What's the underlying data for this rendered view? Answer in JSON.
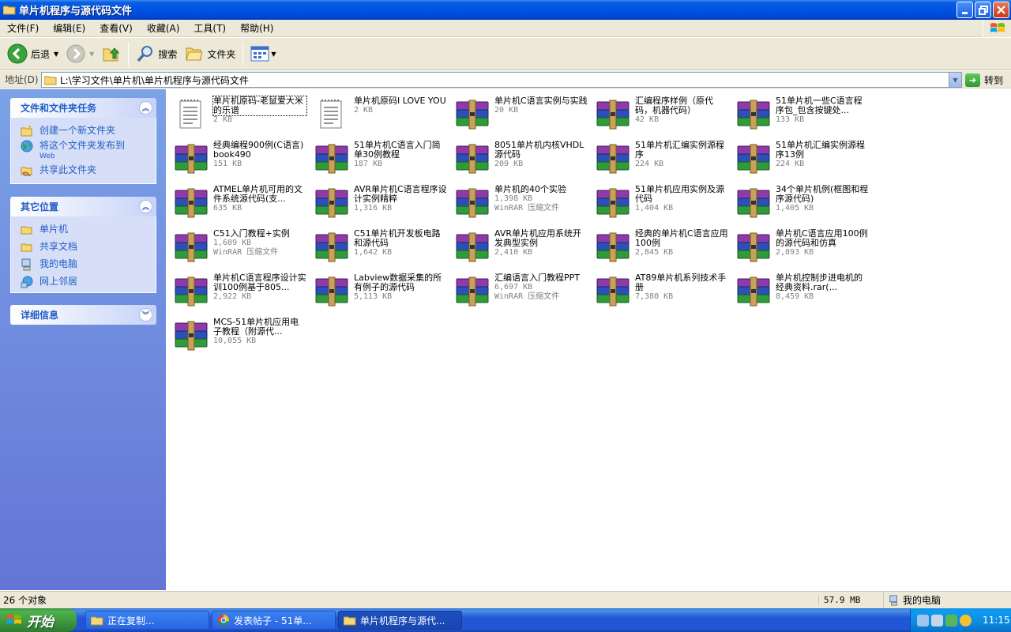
{
  "window": {
    "title": "单片机程序与源代码文件"
  },
  "menu": [
    "文件(F)",
    "编辑(E)",
    "查看(V)",
    "收藏(A)",
    "工具(T)",
    "帮助(H)"
  ],
  "toolbar": {
    "back": "后退",
    "search": "搜索",
    "folders": "文件夹"
  },
  "address": {
    "label": "地址(D)",
    "path": "L:\\学习文件\\单片机\\单片机程序与源代码文件",
    "go": "转到"
  },
  "left_pane": {
    "tasks": {
      "title": "文件和文件夹任务",
      "items": [
        "创建一个新文件夹",
        "将这个文件夹发布到",
        "共享此文件夹"
      ],
      "publish_sub": "Web"
    },
    "places": {
      "title": "其它位置",
      "items": [
        "单片机",
        "共享文档",
        "我的电脑",
        "网上邻居"
      ]
    },
    "details": {
      "title": "详细信息"
    }
  },
  "files": [
    {
      "name": "单片机原码-老鼠爱大米的乐谱",
      "meta": "2 KB",
      "type": "txt"
    },
    {
      "name": "单片机原码I LOVE YOU",
      "meta": "2 KB",
      "type": "txt"
    },
    {
      "name": "单片机C语言实例与实践",
      "meta": "20 KB",
      "type": "rar"
    },
    {
      "name": "汇编程序样例（原代码，机器代码）",
      "meta": "42 KB",
      "type": "rar"
    },
    {
      "name": "51单片机一些C语言程序包_包含按键处...",
      "meta": "133 KB",
      "type": "rar"
    },
    {
      "name": "经典编程900例(C语言) book490",
      "meta": "151 KB",
      "type": "rar"
    },
    {
      "name": "51单片机C语言入门简单30例教程",
      "meta": "187 KB",
      "type": "rar"
    },
    {
      "name": "8051单片机内核VHDL源代码",
      "meta": "209 KB",
      "type": "rar"
    },
    {
      "name": "51单片机汇编实例源程序",
      "meta": "224 KB",
      "type": "rar"
    },
    {
      "name": "51单片机汇编实例源程序13例",
      "meta": "224 KB",
      "type": "rar"
    },
    {
      "name": "ATMEL单片机可用的文件系统源代码(支...",
      "meta": "635 KB",
      "type": "rar"
    },
    {
      "name": "AVR单片机C语言程序设计实例精粹",
      "meta": "1,316 KB",
      "type": "rar"
    },
    {
      "name": "单片机的40个实验",
      "meta": "1,398 KB",
      "meta2": "WinRAR 压缩文件",
      "type": "rar"
    },
    {
      "name": "51单片机应用实例及源代码",
      "meta": "1,404 KB",
      "type": "rar"
    },
    {
      "name": "34个单片机例(框图和程序源代码)",
      "meta": "1,405 KB",
      "type": "rar"
    },
    {
      "name": "C51入门教程+实例",
      "meta": "1,609 KB",
      "meta2": "WinRAR 压缩文件",
      "type": "rar"
    },
    {
      "name": "C51单片机开发板电路和源代码",
      "meta": "1,642 KB",
      "type": "rar"
    },
    {
      "name": "AVR单片机应用系统开发典型实例",
      "meta": "2,410 KB",
      "type": "rar"
    },
    {
      "name": "经典的单片机C语言应用100例",
      "meta": "2,845 KB",
      "type": "rar"
    },
    {
      "name": "单片机C语言应用100例的源代码和仿真",
      "meta": "2,893 KB",
      "type": "rar"
    },
    {
      "name": "单片机C语言程序设计实训100例基于805...",
      "meta": "2,922 KB",
      "type": "rar"
    },
    {
      "name": "Labview数据采集的所有例子的源代码",
      "meta": "5,113 KB",
      "type": "rar"
    },
    {
      "name": "汇编语言入门教程PPT",
      "meta": "6,697 KB",
      "meta2": "WinRAR 压缩文件",
      "type": "rar"
    },
    {
      "name": "AT89单片机系列技术手册",
      "meta": "7,380 KB",
      "type": "rar"
    },
    {
      "name": "单片机控制步进电机的经典资料.rar(...",
      "meta": "8,459 KB",
      "type": "rar"
    },
    {
      "name": "MCS-51单片机应用电子教程（附源代...",
      "meta": "10,055 KB",
      "type": "rar"
    }
  ],
  "status": {
    "count": "26 个对象",
    "size": "57.9 MB",
    "location": "我的电脑"
  },
  "taskbar": {
    "start": "开始",
    "tasks": [
      "正在复制...",
      "发表帖子 - 51单...",
      "单片机程序与源代..."
    ],
    "clock": "11:15"
  }
}
